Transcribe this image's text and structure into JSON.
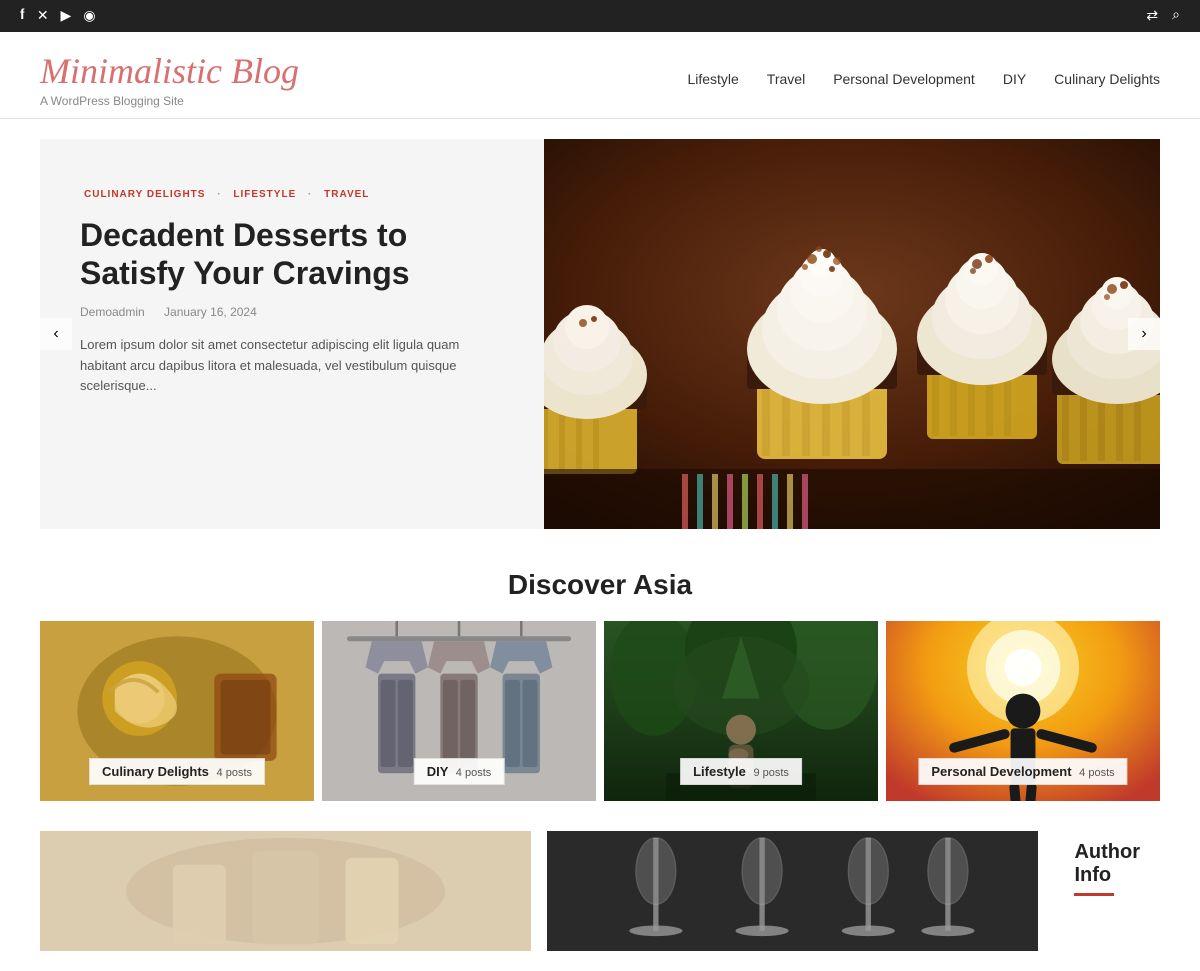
{
  "topbar": {
    "social": [
      {
        "name": "facebook",
        "icon": "f",
        "label": "Facebook"
      },
      {
        "name": "twitter-x",
        "icon": "✕",
        "label": "X"
      },
      {
        "name": "youtube",
        "icon": "▶",
        "label": "YouTube"
      },
      {
        "name": "instagram",
        "icon": "◉",
        "label": "Instagram"
      }
    ],
    "actions": [
      {
        "name": "shuffle",
        "icon": "⇄",
        "label": "Shuffle"
      },
      {
        "name": "search",
        "icon": "⌕",
        "label": "Search"
      }
    ]
  },
  "header": {
    "site_title": "Minimalistic Blog",
    "site_subtitle": "A WordPress Blogging Site",
    "nav": [
      {
        "label": "Lifestyle",
        "href": "#"
      },
      {
        "label": "Travel",
        "href": "#"
      },
      {
        "label": "Personal Development",
        "href": "#"
      },
      {
        "label": "DIY",
        "href": "#"
      },
      {
        "label": "Culinary Delights",
        "href": "#"
      }
    ]
  },
  "hero": {
    "categories": "CULINARY DELIGHTS · LIFESTYLE · TRAVEL",
    "title": "Decadent Desserts to Satisfy Your Cravings",
    "author": "Demoadmin",
    "date": "January 16, 2024",
    "excerpt": "Lorem ipsum dolor sit amet consectetur adipiscing elit ligula quam habitant arcu dapibus litora et malesuada, vel vestibulum quisque scelerisque...",
    "prev_label": "‹",
    "next_label": "›"
  },
  "discover_section": {
    "title": "Discover Asia"
  },
  "categories": [
    {
      "name": "Culinary Delights",
      "posts": "4 posts",
      "bg_colors": [
        "#c8a04a",
        "#8B6914",
        "#d4a520"
      ],
      "type": "food"
    },
    {
      "name": "DIY",
      "posts": "4 posts",
      "bg_colors": [
        "#9e9e9e",
        "#757575",
        "#bdbdbd"
      ],
      "type": "fashion"
    },
    {
      "name": "Lifestyle",
      "posts": "9 posts",
      "bg_colors": [
        "#2d5a27",
        "#1a3a16",
        "#4a7a42"
      ],
      "type": "nature"
    },
    {
      "name": "Personal Development",
      "posts": "4 posts",
      "bg_colors": [
        "#e67e22",
        "#d35400",
        "#f39c12"
      ],
      "type": "silhouette"
    }
  ],
  "bottom": {
    "author_info_title": "Author Info"
  }
}
